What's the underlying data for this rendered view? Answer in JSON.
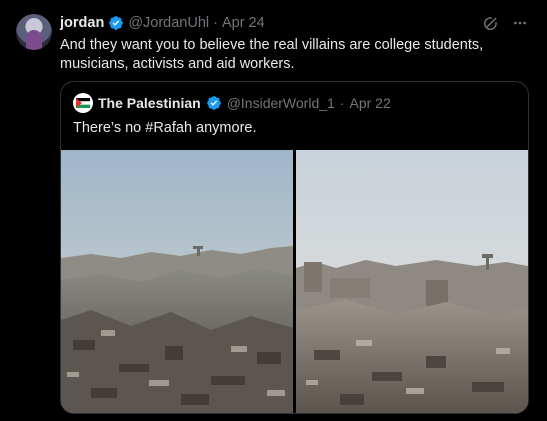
{
  "tweet": {
    "name": "jordan",
    "handle": "@JordanUhl",
    "separator": "·",
    "date": "Apr 24",
    "text": "And they want you to believe the real villains are college students, musicians, activists and aid workers."
  },
  "quote": {
    "name": "The Palestinian",
    "handle": "@InsiderWorld_1",
    "separator": "·",
    "date": "Apr 22",
    "text": "There’s no #Rafah anymore."
  },
  "colors": {
    "verified": "#1d9bf0",
    "muted": "#71767b",
    "border": "#2f3336"
  },
  "icons": [
    "grok-icon",
    "more-icon",
    "verified-icon"
  ]
}
